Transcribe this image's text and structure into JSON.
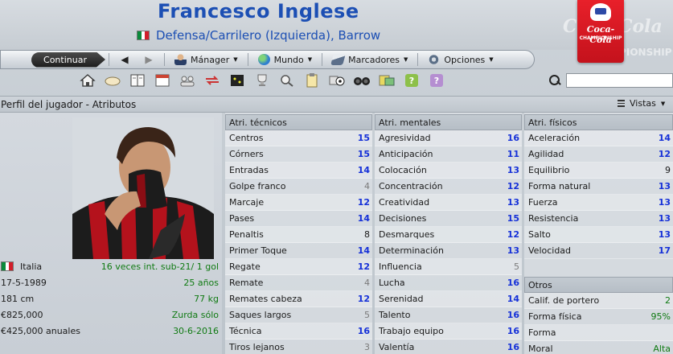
{
  "header": {
    "player_name": "Francesco Inglese",
    "position": "Defensa/Carrilero (Izquierda), Barrow",
    "competition_logo_text": "Coca-Cola",
    "competition_logo_subtext": "CHAMPIONSHIP",
    "nationality_flag_colors": [
      "#0a8a3b",
      "#ffffff",
      "#d21f2b"
    ]
  },
  "toolbar": {
    "continue": "Continuar",
    "menus": [
      {
        "label": "Mánager",
        "icon": "manager-icon"
      },
      {
        "label": "Mundo",
        "icon": "globe-icon"
      },
      {
        "label": "Marcadores",
        "icon": "bookmark-icon"
      },
      {
        "label": "Opciones",
        "icon": "gear-icon"
      }
    ]
  },
  "icon_row": [
    "home-icon",
    "bread-icon",
    "book-icon",
    "calendar-icon",
    "people-icon",
    "transfer-icon",
    "tactics-icon",
    "trophy-icon",
    "scout-icon",
    "clipboard-icon",
    "ball-icon",
    "binoculars-icon",
    "news-icon",
    "help-icon",
    "question-icon"
  ],
  "section": {
    "title": "Perfil del jugador - Atributos",
    "views": "Vistas"
  },
  "player_info": [
    {
      "left": "Italia",
      "right": "16 veces int. sub-21/ 1 gol",
      "flag": true
    },
    {
      "left": "17-5-1989",
      "right": "25 años"
    },
    {
      "left": "181 cm",
      "right": "77 kg"
    },
    {
      "left": "€825,000",
      "right": "Zurda sólo"
    },
    {
      "left": "€425,000 anuales",
      "right": "30-6-2016"
    }
  ],
  "technical": {
    "title": "Atri. técnicos",
    "rows": [
      {
        "name": "Centros",
        "value": "15",
        "tone": "blue"
      },
      {
        "name": "Córners",
        "value": "15",
        "tone": "blue"
      },
      {
        "name": "Entradas",
        "value": "14",
        "tone": "blue"
      },
      {
        "name": "Golpe franco",
        "value": "4",
        "tone": "gray"
      },
      {
        "name": "Marcaje",
        "value": "12",
        "tone": "blue"
      },
      {
        "name": "Pases",
        "value": "14",
        "tone": "blue"
      },
      {
        "name": "Penaltis",
        "value": "8",
        "tone": "dark"
      },
      {
        "name": "Primer Toque",
        "value": "14",
        "tone": "blue"
      },
      {
        "name": "Regate",
        "value": "12",
        "tone": "blue"
      },
      {
        "name": "Remate",
        "value": "4",
        "tone": "gray"
      },
      {
        "name": "Remates cabeza",
        "value": "12",
        "tone": "blue"
      },
      {
        "name": "Saques largos",
        "value": "5",
        "tone": "gray"
      },
      {
        "name": "Técnica",
        "value": "16",
        "tone": "blue"
      },
      {
        "name": "Tiros lejanos",
        "value": "3",
        "tone": "gray"
      }
    ]
  },
  "mental": {
    "title": "Atri. mentales",
    "rows": [
      {
        "name": "Agresividad",
        "value": "16",
        "tone": "blue"
      },
      {
        "name": "Anticipación",
        "value": "11",
        "tone": "blue"
      },
      {
        "name": "Colocación",
        "value": "13",
        "tone": "blue"
      },
      {
        "name": "Concentración",
        "value": "12",
        "tone": "blue"
      },
      {
        "name": "Creatividad",
        "value": "13",
        "tone": "blue"
      },
      {
        "name": "Decisiones",
        "value": "15",
        "tone": "blue"
      },
      {
        "name": "Desmarques",
        "value": "12",
        "tone": "blue"
      },
      {
        "name": "Determinación",
        "value": "13",
        "tone": "blue"
      },
      {
        "name": "Influencia",
        "value": "5",
        "tone": "gray"
      },
      {
        "name": "Lucha",
        "value": "16",
        "tone": "blue"
      },
      {
        "name": "Serenidad",
        "value": "14",
        "tone": "blue"
      },
      {
        "name": "Talento",
        "value": "16",
        "tone": "blue"
      },
      {
        "name": "Trabajo equipo",
        "value": "16",
        "tone": "blue"
      },
      {
        "name": "Valentía",
        "value": "16",
        "tone": "blue"
      }
    ]
  },
  "physical": {
    "title": "Atri. físicos",
    "rows": [
      {
        "name": "Aceleración",
        "value": "14",
        "tone": "blue"
      },
      {
        "name": "Agilidad",
        "value": "12",
        "tone": "blue"
      },
      {
        "name": "Equilibrio",
        "value": "9",
        "tone": "dark"
      },
      {
        "name": "Forma natural",
        "value": "13",
        "tone": "blue"
      },
      {
        "name": "Fuerza",
        "value": "13",
        "tone": "blue"
      },
      {
        "name": "Resistencia",
        "value": "13",
        "tone": "blue"
      },
      {
        "name": "Salto",
        "value": "13",
        "tone": "blue"
      },
      {
        "name": "Velocidad",
        "value": "17",
        "tone": "blue"
      }
    ]
  },
  "others": {
    "title": "Otros",
    "rows": [
      {
        "name": "Calif. de portero",
        "value": "2",
        "tone": "green"
      },
      {
        "name": "Forma física",
        "value": "95%",
        "tone": "green"
      },
      {
        "name": "Forma",
        "value": "",
        "tone": "green"
      },
      {
        "name": "Moral",
        "value": "Alta",
        "tone": "green"
      }
    ]
  }
}
